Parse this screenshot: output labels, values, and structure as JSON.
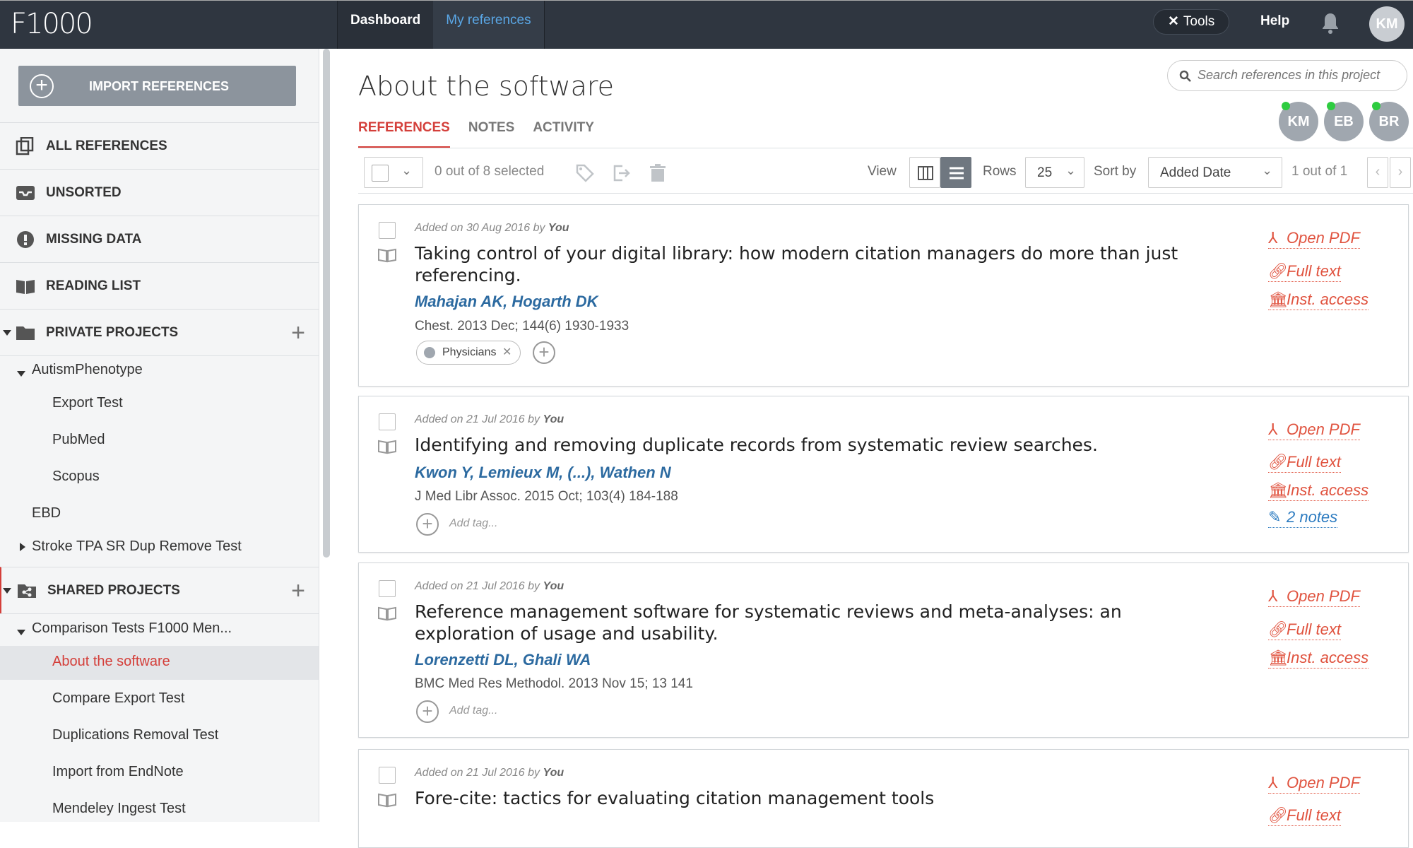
{
  "topbar": {
    "logo": "F1000",
    "nav": [
      {
        "label": "Dashboard",
        "active": false
      },
      {
        "label": "My references",
        "active": true
      }
    ],
    "tools_label": "Tools",
    "help_label": "Help",
    "user_initials": "KM"
  },
  "sidebar": {
    "import_label": "IMPORT REFERENCES",
    "all_references": "ALL REFERENCES",
    "unsorted": "UNSORTED",
    "missing_data": "MISSING DATA",
    "reading_list": "READING LIST",
    "private_projects": "PRIVATE PROJECTS",
    "private_tree": {
      "autism": "AutismPhenotype",
      "export_test": "Export Test",
      "pubmed": "PubMed",
      "scopus": "Scopus",
      "ebd": "EBD",
      "stroke": "Stroke TPA SR Dup Remove Test"
    },
    "shared_projects": "SHARED PROJECTS",
    "shared_tree": {
      "comparison": "Comparison Tests F1000 Men...",
      "about": "About the software",
      "compare_export": "Compare Export Test",
      "duplications": "Duplications Removal Test",
      "endnote": "Import from EndNote",
      "mendeley": "Mendeley Ingest Test"
    }
  },
  "main": {
    "title": "About the software",
    "search_placeholder": "Search references in this project",
    "collaborators": [
      "KM",
      "EB",
      "BR"
    ],
    "tabs": {
      "references": "REFERENCES",
      "notes": "NOTES",
      "activity": "ACTIVITY"
    },
    "toolbar": {
      "selected": "0 out of 8 selected",
      "view_label": "View",
      "rows_label": "Rows",
      "rows_value": "25",
      "sort_label": "Sort by",
      "sort_value": "Added Date",
      "page_info": "1 out of 1"
    }
  },
  "references": [
    {
      "added_prefix": "Added on 30 Aug 2016",
      "added_by_word": "by",
      "added_by": "You",
      "title_line1": "Taking control of your digital library: how modern citation managers do more than just",
      "title_line2": "referencing.",
      "authors": "Mahajan AK, Hogarth DK",
      "journal": "Chest. 2013 Dec; 144(6) 1930-1933",
      "tag": "Physicians",
      "links": [
        "Open PDF",
        "Full text",
        "Inst. access"
      ]
    },
    {
      "added_prefix": "Added on 21 Jul 2016",
      "added_by_word": "by",
      "added_by": "You",
      "title_line1": "Identifying and removing duplicate records from systematic review searches.",
      "authors": "Kwon Y, Lemieux M, (...), Wathen N",
      "journal": "J Med Libr Assoc. 2015 Oct; 103(4) 184-188",
      "add_tag": "Add tag...",
      "links": [
        "Open PDF",
        "Full text",
        "Inst. access"
      ],
      "notes_link": "2 notes"
    },
    {
      "added_prefix": "Added on 21 Jul 2016",
      "added_by_word": "by",
      "added_by": "You",
      "title_line1": "Reference management software for systematic reviews and meta-analyses: an",
      "title_line2": "exploration of usage and usability.",
      "authors": "Lorenzetti DL, Ghali WA",
      "journal": "BMC Med Res Methodol. 2013 Nov 15; 13 141",
      "add_tag": "Add tag...",
      "links": [
        "Open PDF",
        "Full text",
        "Inst. access"
      ]
    },
    {
      "added_prefix": "Added on 21 Jul 2016",
      "added_by_word": "by",
      "added_by": "You",
      "title_line1": "Fore-cite: tactics for evaluating citation management tools",
      "links": [
        "Open PDF",
        "Full text"
      ]
    }
  ]
}
